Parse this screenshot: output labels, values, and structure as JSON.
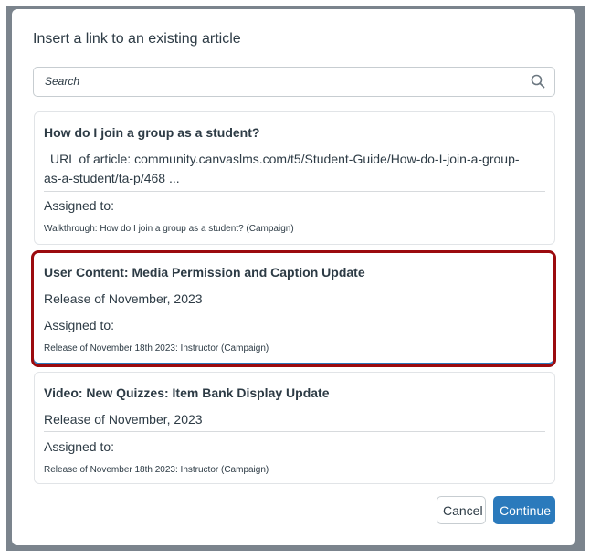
{
  "dialog": {
    "title": "Insert a link to an existing article",
    "search": {
      "placeholder": "Search",
      "value": ""
    },
    "articles": [
      {
        "title": "How do I join a group as a student?",
        "detail_line1": "URL of article: community.canvaslms.com/t5/Student-Guide/How-do-I-join-a-group-",
        "detail_line2": "as-a-student/ta-p/468   ...",
        "assigned_label": "Assigned to:",
        "assigned_value": "Walkthrough: How do I join a group as a student? (Campaign)",
        "selected": false
      },
      {
        "title": "User Content: Media Permission and Caption Update",
        "detail_line1": "Release of November, 2023",
        "assigned_label": "Assigned to:",
        "assigned_value": "Release of November 18th 2023: Instructor (Campaign)",
        "selected": true
      },
      {
        "title": "Video: New Quizzes: Item Bank Display Update",
        "detail_line1": "Release of November, 2023",
        "assigned_label": "Assigned to:",
        "assigned_value": "Release of November 18th 2023: Instructor (Campaign)",
        "selected": false
      }
    ],
    "cancel_label": "Cancel",
    "continue_label": "Continue"
  },
  "colors": {
    "accent": "#2b7abc",
    "highlight": "#9b0a0e"
  }
}
